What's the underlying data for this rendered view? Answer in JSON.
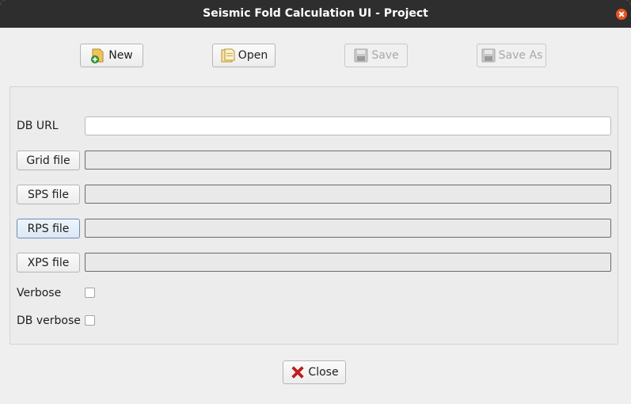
{
  "window": {
    "title": "Seismic Fold Calculation UI - Project"
  },
  "toolbar": {
    "new_label": "New",
    "open_label": "Open",
    "save_label": "Save",
    "save_as_label": "Save As"
  },
  "form": {
    "db_url_label": "DB URL",
    "db_url_value": "",
    "grid_file_button": "Grid file",
    "grid_file_value": "",
    "sps_file_button": "SPS file",
    "sps_file_value": "",
    "rps_file_button": "RPS file",
    "rps_file_value": "",
    "xps_file_button": "XPS file",
    "xps_file_value": "",
    "verbose_label": "Verbose",
    "verbose_checked": false,
    "db_verbose_label": "DB verbose",
    "db_verbose_checked": false
  },
  "footer": {
    "close_label": "Close"
  },
  "icons": {
    "titlebar_close": "close-icon",
    "new": "new-file-icon",
    "open": "open-folder-icon",
    "save": "save-icon",
    "save_as": "save-as-icon",
    "close": "close-icon"
  },
  "colors": {
    "titlebar": "#2e2e2e",
    "close_accent": "#e95420",
    "close_icon_red": "#d81b1b"
  }
}
